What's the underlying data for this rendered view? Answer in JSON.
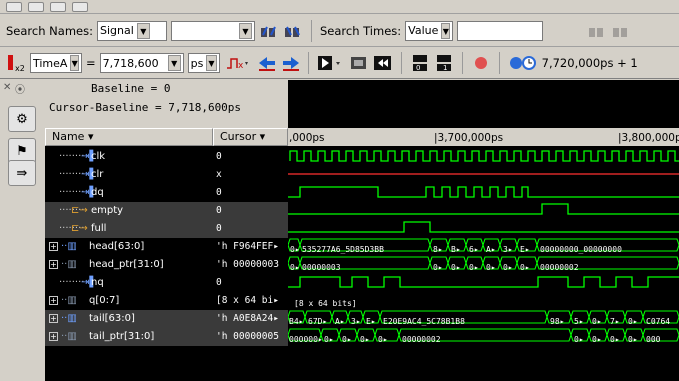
{
  "search": {
    "names_label": "Search Names:",
    "names_type": "Signal",
    "names_value": "",
    "times_label": "Search Times:",
    "times_type": "Value",
    "times_value": ""
  },
  "toolbar": {
    "time_marker": "TimeA",
    "equals": "=",
    "time_value": "7,718,600",
    "time_unit": "ps",
    "cursor_readout": "7,720,000ps + 1"
  },
  "baseline": {
    "baseline_text": "Baseline = 0",
    "cursor_baseline_text": "Cursor-Baseline = 7,718,600ps"
  },
  "columns": {
    "name_header": "Name",
    "cursor_header": "Cursor"
  },
  "timeline": {
    "labels": [
      ",000ps",
      "|3,700,000ps",
      "|3,800,000p"
    ]
  },
  "signals": [
    {
      "name": "clk",
      "cursor": "0"
    },
    {
      "name": "clr",
      "cursor": "x"
    },
    {
      "name": "dq",
      "cursor": "0"
    },
    {
      "name": "empty",
      "cursor": "0"
    },
    {
      "name": "full",
      "cursor": "0"
    },
    {
      "name": "head[63:0]",
      "cursor": "'h F964FEF▸"
    },
    {
      "name": "head_ptr[31:0]",
      "cursor": "'h 00000003"
    },
    {
      "name": "nq",
      "cursor": "0"
    },
    {
      "name": "q[0:7]",
      "cursor": "[8 x 64 bi▸"
    },
    {
      "name": "tail[63:0]",
      "cursor": "'h A0E8A24▸"
    },
    {
      "name": "tail_ptr[31:0]",
      "cursor": "'h 00000005"
    }
  ],
  "bus_values": {
    "head": [
      "0▸",
      "535277A6_5D85D3BB",
      "8▸",
      "B▸",
      "6▸",
      "A▸",
      "3▸",
      "E▸",
      "00000000_00000000"
    ],
    "head_ptr": [
      "0▸",
      "00000003",
      "0▸",
      "0▸",
      "0▸",
      "0▸",
      "0▸",
      "0▸",
      "00000002"
    ],
    "q": [
      "[8 x 64 bits]"
    ],
    "tail": [
      "B4▸",
      "67D▸",
      "A▸",
      "3▸",
      "E▸",
      "E20E9AC4_5C78B1B8",
      "98▸",
      "5▸",
      "0▸",
      "7▸",
      "0▸",
      "C0764"
    ],
    "tail_ptr": [
      "000000▸",
      "0▸",
      "0▸",
      "0▸",
      "0▸",
      "00000002",
      "0▸",
      "0▸",
      "0▸",
      "0▸",
      "000"
    ]
  },
  "colors": {
    "wave": "#00ff00",
    "x_state": "#ff3030",
    "background": "#000000",
    "toolbar": "#d4d0c8"
  }
}
